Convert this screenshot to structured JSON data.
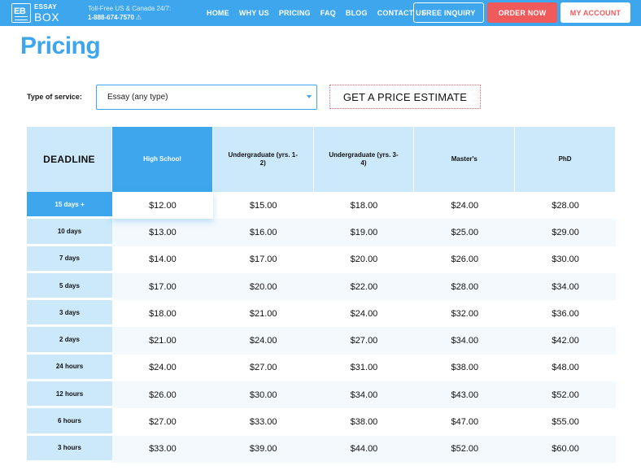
{
  "header": {
    "logo_top": "ESSAY",
    "logo_bottom": "BOX",
    "logo_mark": "EB",
    "tollfree_label": "Toll-Free US & Canada 24/7:",
    "tollfree_phone": "1-888-674-7570",
    "nav": [
      "HOME",
      "WHY US",
      "PRICING",
      "FAQ",
      "BLOG",
      "CONTACT US"
    ],
    "inquiry_label": "FREE INQUIRY",
    "order_label": "ORDER NOW",
    "account_label": "MY ACCOUNT",
    "colors": {
      "primary": "#3da6ec",
      "accent": "#f05a5b"
    }
  },
  "page": {
    "title": "Pricing"
  },
  "service": {
    "label": "Type of service:",
    "selected": "Essay (any type)",
    "estimate_label": "GET A PRICE ESTIMATE"
  },
  "table": {
    "deadline_header": "DEADLINE",
    "levels": [
      "High School",
      "Undergraduate (yrs. 1-2)",
      "Undergraduate (yrs. 3-4)",
      "Master's",
      "PhD"
    ],
    "rows": [
      {
        "deadline": "15 days +",
        "prices": [
          "$12.00",
          "$15.00",
          "$18.00",
          "$24.00",
          "$28.00"
        ]
      },
      {
        "deadline": "10 days",
        "prices": [
          "$13.00",
          "$16.00",
          "$19.00",
          "$25.00",
          "$29.00"
        ]
      },
      {
        "deadline": "7 days",
        "prices": [
          "$14.00",
          "$17.00",
          "$20.00",
          "$26.00",
          "$30.00"
        ]
      },
      {
        "deadline": "5 days",
        "prices": [
          "$17.00",
          "$20.00",
          "$22.00",
          "$28.00",
          "$34.00"
        ]
      },
      {
        "deadline": "3 days",
        "prices": [
          "$18.00",
          "$21.00",
          "$24.00",
          "$32.00",
          "$36.00"
        ]
      },
      {
        "deadline": "2 days",
        "prices": [
          "$21.00",
          "$24.00",
          "$27.00",
          "$34.00",
          "$42.00"
        ]
      },
      {
        "deadline": "24 hours",
        "prices": [
          "$24.00",
          "$27.00",
          "$31.00",
          "$38.00",
          "$48.00"
        ]
      },
      {
        "deadline": "12 hours",
        "prices": [
          "$26.00",
          "$30.00",
          "$34.00",
          "$43.00",
          "$52.00"
        ]
      },
      {
        "deadline": "6 hours",
        "prices": [
          "$27.00",
          "$33.00",
          "$38.00",
          "$47.00",
          "$55.00"
        ]
      },
      {
        "deadline": "3 hours",
        "prices": [
          "$33.00",
          "$39.00",
          "$44.00",
          "$52.00",
          "$60.00"
        ]
      }
    ]
  }
}
